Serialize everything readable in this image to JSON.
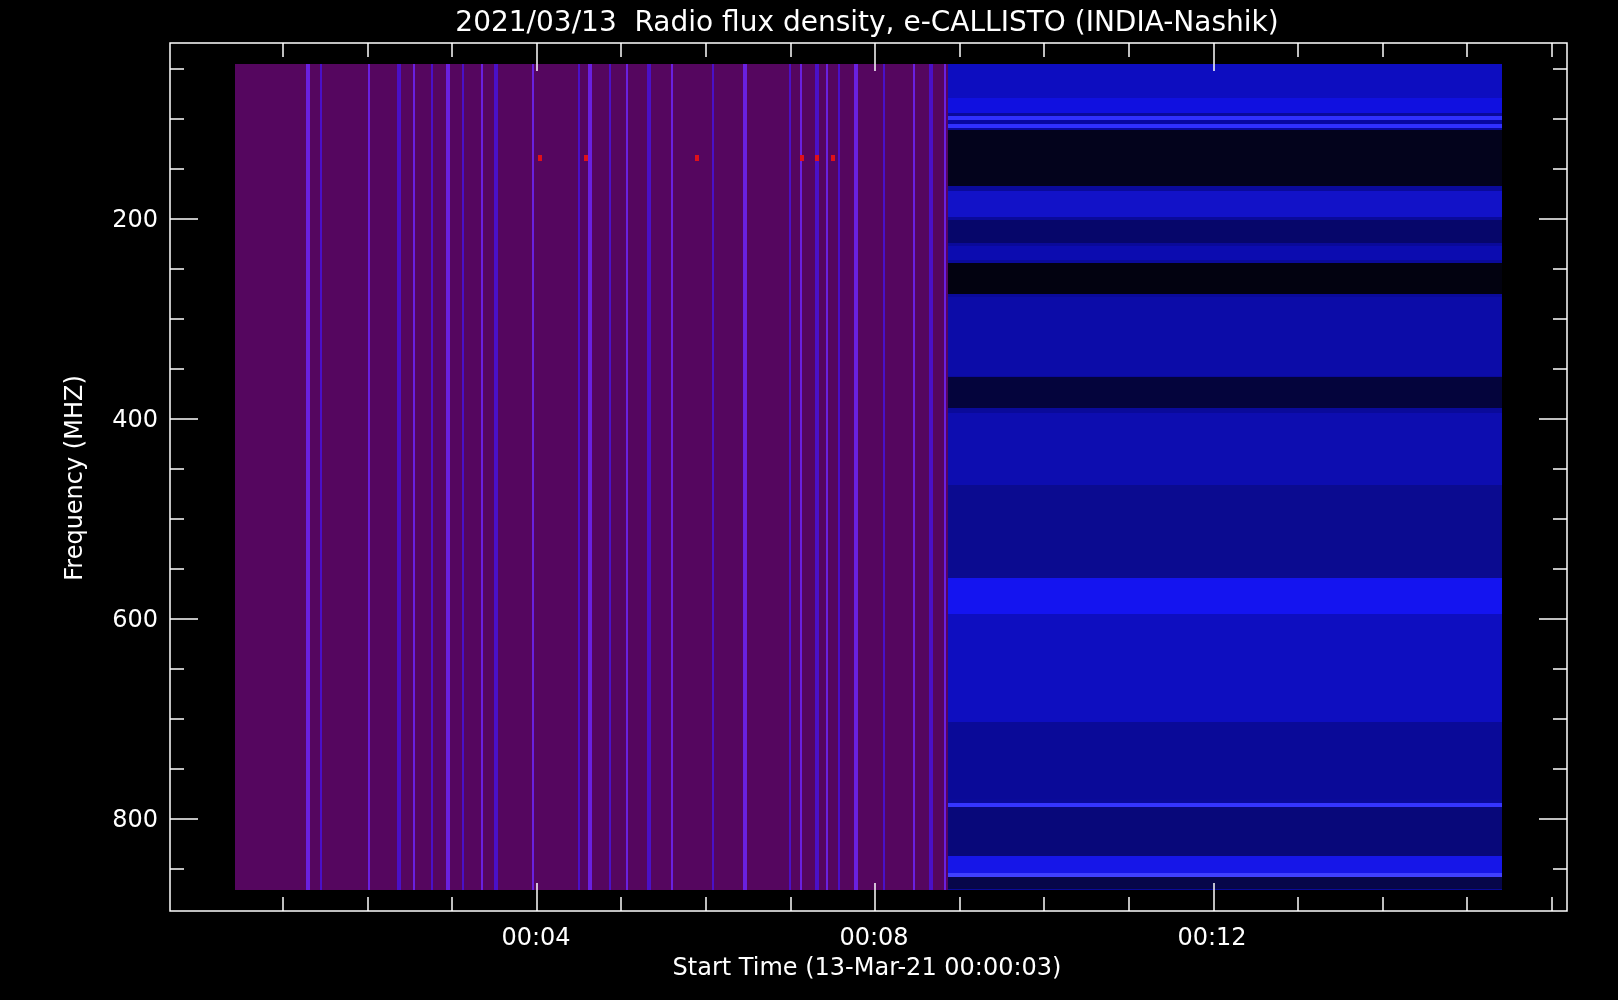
{
  "plot": {
    "title": "2021/03/13  Radio flux density, e-CALLISTO (INDIA-Nashik)",
    "ylabel": "Frequency (MHZ)",
    "xlabel": "Start Time (13-Mar-21 00:00:03)",
    "yticks": [
      {
        "label": "200"
      },
      {
        "label": "400"
      },
      {
        "label": "600"
      },
      {
        "label": "800"
      }
    ],
    "xticks": [
      {
        "label": "00:04"
      },
      {
        "label": "00:08"
      },
      {
        "label": "00:12"
      }
    ]
  }
}
